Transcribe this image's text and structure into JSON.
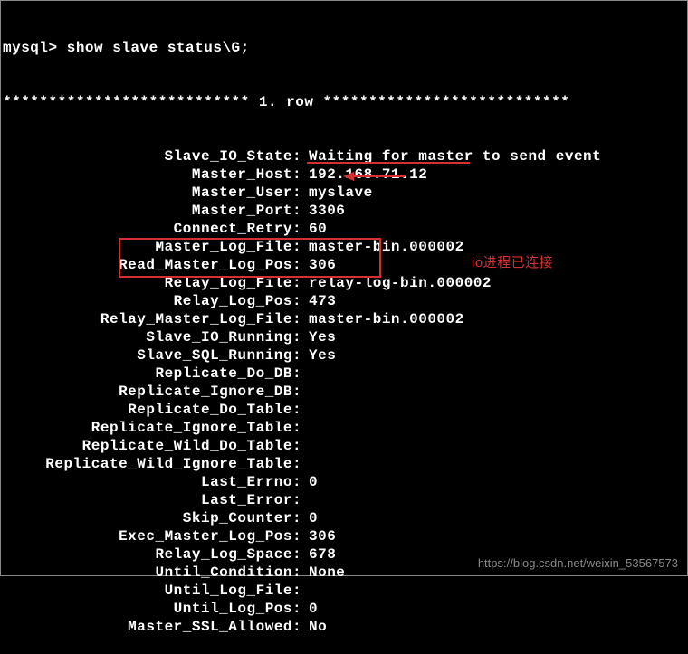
{
  "prompt": "mysql> show slave status\\G;",
  "header": "*************************** 1. row ***************************",
  "rows": [
    {
      "label": "Slave_IO_State",
      "value": "Waiting for master to send event"
    },
    {
      "label": "Master_Host",
      "value": "192.168.71.12"
    },
    {
      "label": "Master_User",
      "value": "myslave"
    },
    {
      "label": "Master_Port",
      "value": "3306"
    },
    {
      "label": "Connect_Retry",
      "value": "60"
    },
    {
      "label": "Master_Log_File",
      "value": "master-bin.000002"
    },
    {
      "label": "Read_Master_Log_Pos",
      "value": "306"
    },
    {
      "label": "Relay_Log_File",
      "value": "relay-log-bin.000002"
    },
    {
      "label": "Relay_Log_Pos",
      "value": "473"
    },
    {
      "label": "Relay_Master_Log_File",
      "value": "master-bin.000002"
    },
    {
      "label": "Slave_IO_Running",
      "value": "Yes"
    },
    {
      "label": "Slave_SQL_Running",
      "value": "Yes"
    },
    {
      "label": "Replicate_Do_DB",
      "value": ""
    },
    {
      "label": "Replicate_Ignore_DB",
      "value": ""
    },
    {
      "label": "Replicate_Do_Table",
      "value": ""
    },
    {
      "label": "Replicate_Ignore_Table",
      "value": ""
    },
    {
      "label": "Replicate_Wild_Do_Table",
      "value": ""
    },
    {
      "label": "Replicate_Wild_Ignore_Table",
      "value": ""
    },
    {
      "label": "Last_Errno",
      "value": "0"
    },
    {
      "label": "Last_Error",
      "value": ""
    },
    {
      "label": "Skip_Counter",
      "value": "0"
    },
    {
      "label": "Exec_Master_Log_Pos",
      "value": "306"
    },
    {
      "label": "Relay_Log_Space",
      "value": "678"
    },
    {
      "label": "Until_Condition",
      "value": "None"
    },
    {
      "label": "Until_Log_File",
      "value": ""
    },
    {
      "label": "Until_Log_Pos",
      "value": "0"
    },
    {
      "label": "Master_SSL_Allowed",
      "value": "No"
    }
  ],
  "annotation": "io进程已连接",
  "watermark": "https://blog.csdn.net/weixin_53567573"
}
